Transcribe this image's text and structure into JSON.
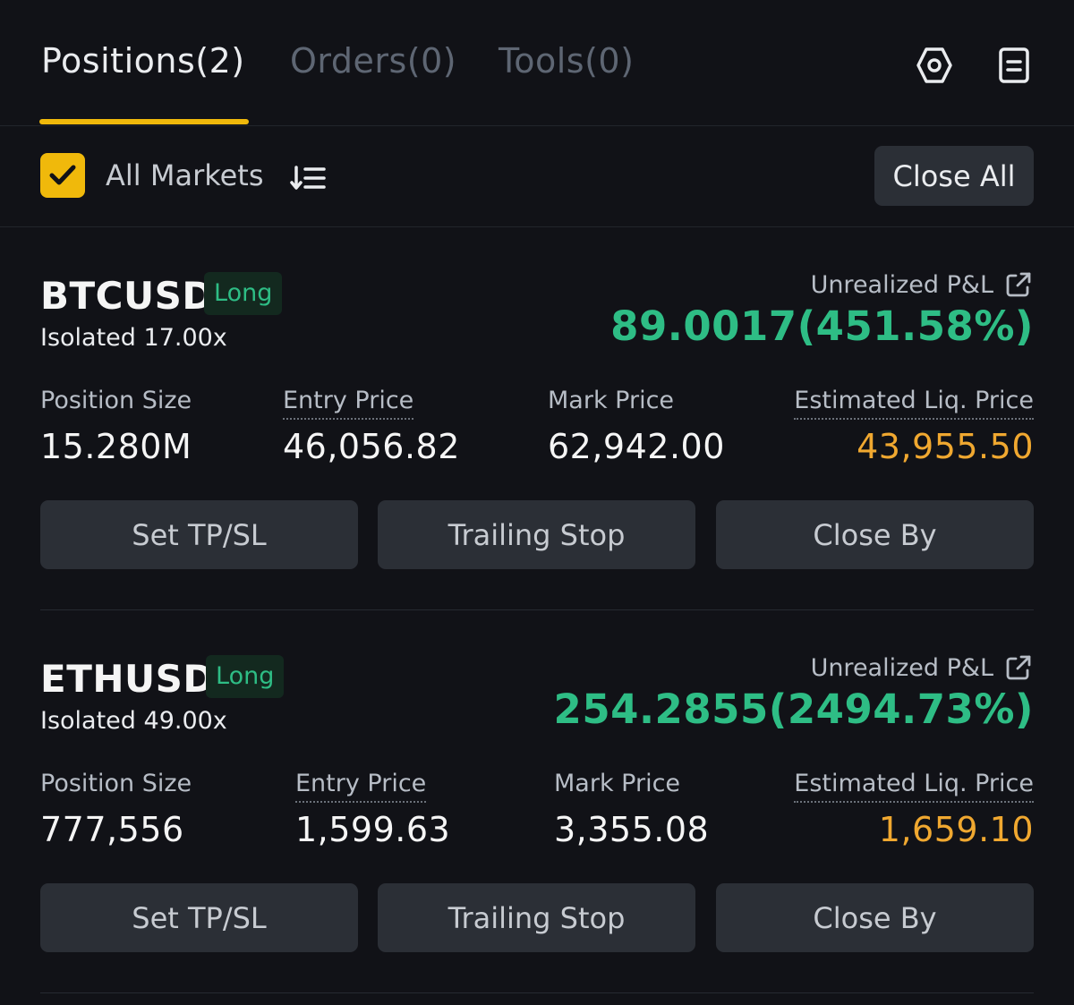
{
  "tabs": [
    {
      "label": "Positions(2)",
      "active": true
    },
    {
      "label": "Orders(0)",
      "active": false
    },
    {
      "label": "Tools(0)",
      "active": false
    }
  ],
  "icons": {
    "settings": "settings-hexagon-icon",
    "report": "report-document-icon",
    "sort": "sort-list-icon",
    "share": "share-external-icon",
    "check": "check-icon"
  },
  "filter": {
    "all_markets_label": "All Markets",
    "all_markets_checked": true,
    "close_all_label": "Close All"
  },
  "colors": {
    "accent": "#f0b90b",
    "profit": "#2ebd85",
    "liq": "#f0a830",
    "background": "#111217",
    "button": "#2b2f36"
  },
  "positions": [
    {
      "symbol": "BTCUSD",
      "side": "Long",
      "margin_mode": "Isolated 17.00x",
      "pnl_label": "Unrealized P&L",
      "pnl_value": "89.0017(451.58%)",
      "fields": {
        "size_label": "Position Size",
        "size_value": "15.280M",
        "entry_label": "Entry Price",
        "entry_value": "46,056.82",
        "mark_label": "Mark Price",
        "mark_value": "62,942.00",
        "liq_label": "Estimated Liq. Price",
        "liq_value": "43,955.50"
      },
      "actions": [
        "Set TP/SL",
        "Trailing Stop",
        "Close By"
      ]
    },
    {
      "symbol": "ETHUSD",
      "side": "Long",
      "margin_mode": "Isolated 49.00x",
      "pnl_label": "Unrealized P&L",
      "pnl_value": "254.2855(2494.73%)",
      "fields": {
        "size_label": "Position Size",
        "size_value": "777,556",
        "entry_label": "Entry Price",
        "entry_value": "1,599.63",
        "mark_label": "Mark Price",
        "mark_value": "3,355.08",
        "liq_label": "Estimated Liq. Price",
        "liq_value": "1,659.10"
      },
      "actions": [
        "Set TP/SL",
        "Trailing Stop",
        "Close By"
      ]
    }
  ]
}
